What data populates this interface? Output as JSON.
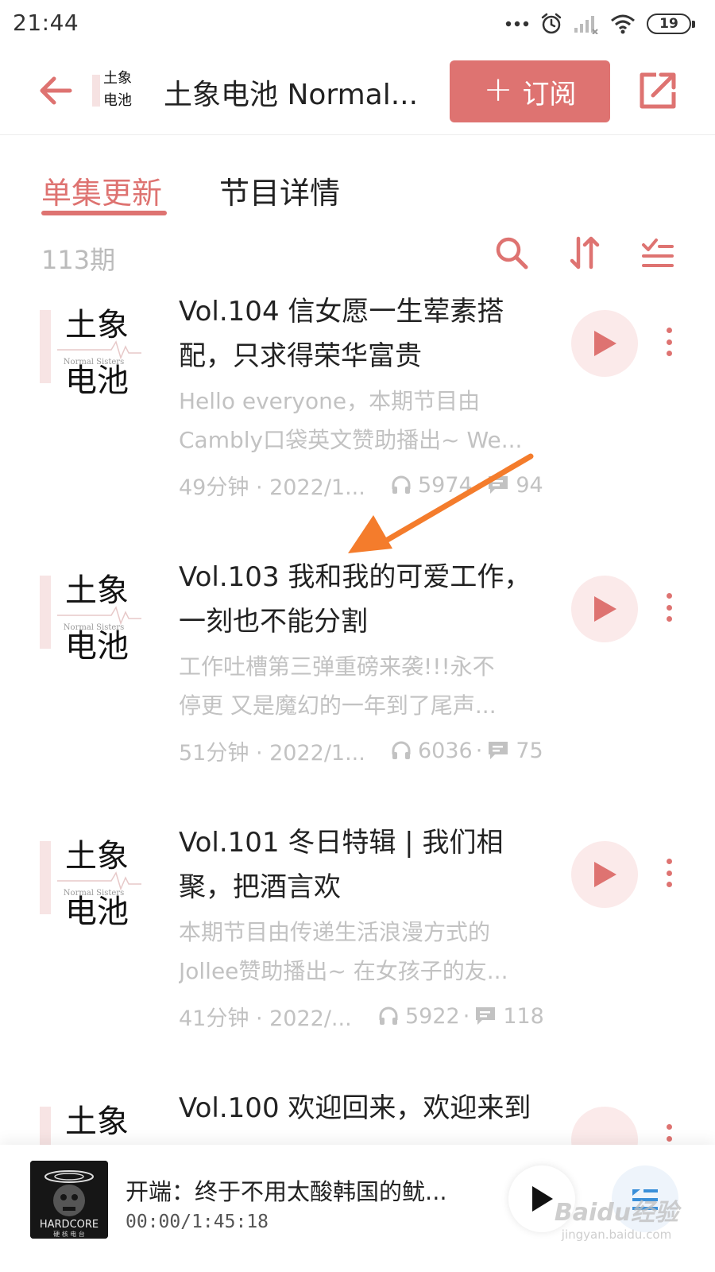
{
  "status_bar": {
    "time": "21:44",
    "battery": "19"
  },
  "header": {
    "cover_text_top": "土象",
    "cover_text_bottom": "电池",
    "title": "土象电池 Normal...",
    "subscribe_plus": "+",
    "subscribe_label": "订阅"
  },
  "tabs": [
    {
      "label": "单集更新",
      "active": true
    },
    {
      "label": "节目详情",
      "active": false
    }
  ],
  "list": {
    "count": "113期"
  },
  "episodes": [
    {
      "title": "Vol.104 信女愿一生荤素搭配，只求得荣华富贵",
      "desc_line1": "Hello everyone，本期节目由",
      "desc_line2": "Cambly口袋英文赞助播出~ We...",
      "duration_date": "49分钟 · 2022/1...",
      "plays": "5974",
      "comments": "94",
      "cover_top": "土象",
      "cover_mid": "Normal  Sisters",
      "cover_bottom": "电池"
    },
    {
      "title": "Vol.103 我和我的可爱工作，一刻也不能分割",
      "desc_line1": "工作吐槽第三弹重磅来袭!!!永不",
      "desc_line2": "停更 又是魔幻的一年到了尾声...",
      "duration_date": "51分钟 · 2022/1...",
      "plays": "6036",
      "comments": "75",
      "cover_top": "土象",
      "cover_mid": "Normal  Sisters",
      "cover_bottom": "电池"
    },
    {
      "title": "Vol.101 冬日特辑 | 我们相聚，把酒言欢",
      "desc_line1": "本期节目由传递生活浪漫方式的",
      "desc_line2": "Jollee赞助播出~ 在女孩子的友...",
      "duration_date": "41分钟 · 2022/...",
      "plays": "5922",
      "comments": "118",
      "cover_top": "土象",
      "cover_mid": "Normal  Sisters",
      "cover_bottom": "电池"
    },
    {
      "title": "Vol.100 欢迎回来，欢迎来到",
      "cover_top": "土象"
    }
  ],
  "player": {
    "title": "开端：终于不用太酸韩国的鱿...",
    "time": "00:00/1:45:18",
    "cover_text": "HARDCORE",
    "cover_subtext": "硬 核 电 台"
  },
  "watermark": {
    "main": "Baidu经验",
    "url": "jingyan.baidu.com"
  },
  "colors": {
    "accent": "#de7371",
    "play_bg": "#fbeaea",
    "muted_text": "#c2c2c2",
    "annotation_arrow": "#f47c2c"
  }
}
